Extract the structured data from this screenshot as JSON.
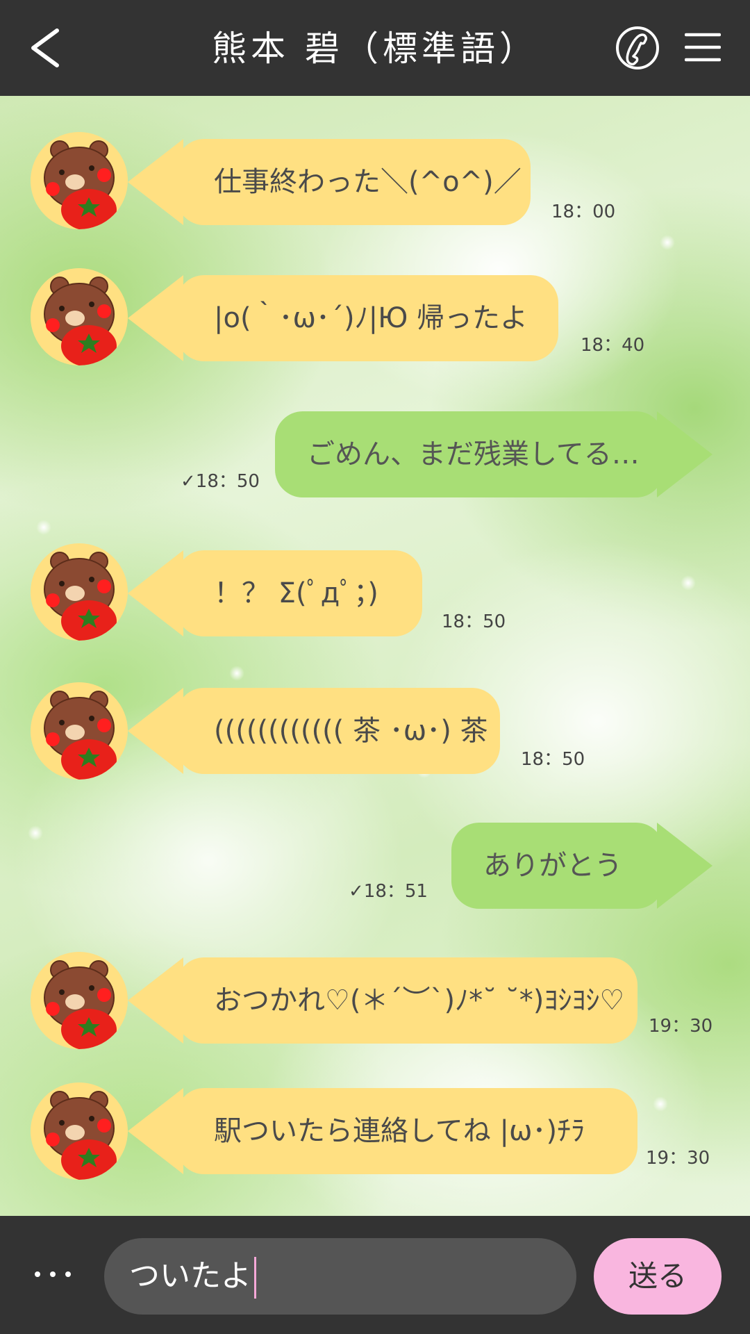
{
  "header": {
    "title": "熊本 碧（標準語）",
    "back_icon": "chevron-left-icon",
    "call_icon": "phone-icon",
    "menu_icon": "hamburger-menu-icon"
  },
  "messages": [
    {
      "side": "in",
      "text": "仕事終わった＼(^o^)／",
      "time": "18：00"
    },
    {
      "side": "in",
      "text": "|o(｀･ω･´)ﾉ|Ю 帰ったよ",
      "time": "18：40"
    },
    {
      "side": "out",
      "text": "ごめん、まだ残業してる…",
      "time": "✓18：50"
    },
    {
      "side": "in",
      "text": "！？ Σ(ﾟдﾟ；)",
      "time": "18：50"
    },
    {
      "side": "in",
      "text": "(((((((((((( 茶 ･ω･) 茶",
      "time": "18：50"
    },
    {
      "side": "out",
      "text": "ありがとう",
      "time": "✓18：51"
    },
    {
      "side": "in",
      "text": "おつかれ♡(＊´︶`)ﾉ*˘ ˘*)ﾖｼﾖｼ♡",
      "time": "19：30"
    },
    {
      "side": "in",
      "text": "駅ついたら連絡してね |ω･)ﾁﾗ",
      "time": "19：30"
    }
  ],
  "footer": {
    "more_icon": "ellipsis-icon",
    "input_value": "ついたよ",
    "send_label": "送る"
  },
  "colors": {
    "header_bg": "#333333",
    "incoming_bubble": "#ffe082",
    "outgoing_bubble": "#a8de75",
    "send_button": "#f9b6df",
    "input_bg": "#555555"
  }
}
